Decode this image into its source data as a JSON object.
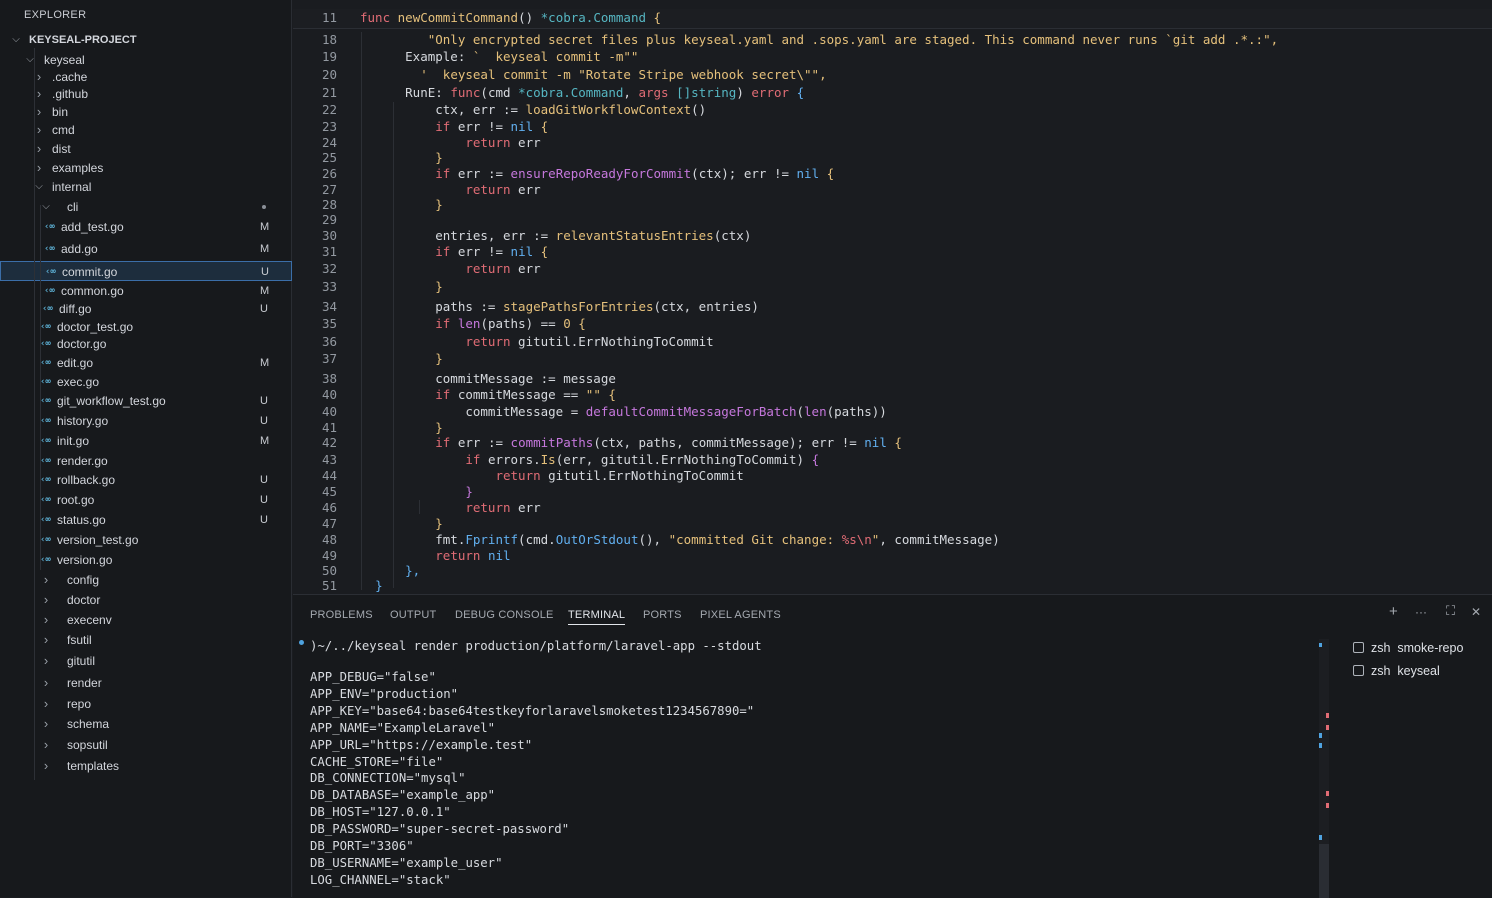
{
  "explorer": {
    "title": "EXPLORER",
    "project": "KEYSEAL-PROJECT",
    "items": [
      {
        "label": "keyseal",
        "kind": "folder-open",
        "depth": 1
      },
      {
        "label": ".cache",
        "kind": "folder",
        "depth": 2
      },
      {
        "label": ".github",
        "kind": "folder",
        "depth": 2
      },
      {
        "label": "bin",
        "kind": "folder",
        "depth": 2
      },
      {
        "label": "cmd",
        "kind": "folder",
        "depth": 2
      },
      {
        "label": "dist",
        "kind": "folder",
        "depth": 2
      },
      {
        "label": "examples",
        "kind": "folder",
        "depth": 2
      },
      {
        "label": "internal",
        "kind": "folder-open",
        "depth": 2
      },
      {
        "label": "cli",
        "kind": "folder-open",
        "depth": 3,
        "dot": true
      },
      {
        "label": "add_test.go",
        "kind": "go",
        "depth": 4,
        "status": "M"
      },
      {
        "label": "add.go",
        "kind": "go",
        "depth": 4,
        "status": "M"
      },
      {
        "label": "commit.go",
        "kind": "go",
        "depth": 4,
        "status": "U",
        "selected": true
      },
      {
        "label": "common.go",
        "kind": "go",
        "depth": 4,
        "status": "M"
      },
      {
        "label": "diff.go",
        "kind": "go",
        "depth": 4,
        "status": "U"
      },
      {
        "label": "doctor_test.go",
        "kind": "go",
        "depth": 4
      },
      {
        "label": "doctor.go",
        "kind": "go",
        "depth": 4
      },
      {
        "label": "edit.go",
        "kind": "go",
        "depth": 4,
        "status": "M"
      },
      {
        "label": "exec.go",
        "kind": "go",
        "depth": 4
      },
      {
        "label": "git_workflow_test.go",
        "kind": "go",
        "depth": 4,
        "status": "U"
      },
      {
        "label": "history.go",
        "kind": "go",
        "depth": 4,
        "status": "U"
      },
      {
        "label": "init.go",
        "kind": "go",
        "depth": 4,
        "status": "M"
      },
      {
        "label": "render.go",
        "kind": "go",
        "depth": 4
      },
      {
        "label": "rollback.go",
        "kind": "go",
        "depth": 4,
        "status": "U"
      },
      {
        "label": "root.go",
        "kind": "go",
        "depth": 4,
        "status": "U"
      },
      {
        "label": "status.go",
        "kind": "go",
        "depth": 4,
        "status": "U"
      },
      {
        "label": "version_test.go",
        "kind": "go",
        "depth": 4
      },
      {
        "label": "version.go",
        "kind": "go",
        "depth": 4
      },
      {
        "label": "config",
        "kind": "folder",
        "depth": 3
      },
      {
        "label": "doctor",
        "kind": "folder",
        "depth": 3
      },
      {
        "label": "execenv",
        "kind": "folder",
        "depth": 3
      },
      {
        "label": "fsutil",
        "kind": "folder",
        "depth": 3
      },
      {
        "label": "gitutil",
        "kind": "folder",
        "depth": 3
      },
      {
        "label": "render",
        "kind": "folder",
        "depth": 3
      },
      {
        "label": "repo",
        "kind": "folder",
        "depth": 3
      },
      {
        "label": "schema",
        "kind": "folder",
        "depth": 3
      },
      {
        "label": "sopsutil",
        "kind": "folder",
        "depth": 3
      },
      {
        "label": "templates",
        "kind": "folder",
        "depth": 3
      }
    ]
  },
  "editor": {
    "file": "commit.go",
    "lines": [
      {
        "n": "11",
        "sticky": true,
        "tokens": [
          [
            "kw",
            "func "
          ],
          [
            "st",
            "newCommitCommand"
          ],
          [
            "pl",
            "() "
          ],
          [
            "ty",
            "*cobra.Command"
          ],
          [
            "br",
            " {"
          ]
        ]
      },
      {
        "n": "18",
        "tokens": [
          [
            "pl",
            "         "
          ],
          [
            "st",
            "\"Only encrypted secret files plus keyseal.yaml and .sops.yaml are staged. This command never runs `git add .*.:\","
          ]
        ]
      },
      {
        "n": "19",
        "tokens": [
          [
            "pl",
            "      Example: "
          ],
          [
            "st",
            "`  keyseal commit -m\"\""
          ]
        ]
      },
      {
        "n": "20",
        "tokens": [
          [
            "pl",
            "        "
          ],
          [
            "st",
            "'  keyseal commit -m \"Rotate Stripe webhook secret\\\"\","
          ]
        ]
      },
      {
        "n": "21",
        "tokens": [
          [
            "pl",
            "      RunE: "
          ],
          [
            "kw",
            "func"
          ],
          [
            "pl",
            "(cmd "
          ],
          [
            "ty",
            "*cobra.Command"
          ],
          [
            "pl",
            ", "
          ],
          [
            "kw",
            "args"
          ],
          [
            "pl",
            " "
          ],
          [
            "ty",
            "[]string"
          ],
          [
            "pl",
            ") "
          ],
          [
            "kw",
            "error"
          ],
          [
            "nl",
            " {"
          ]
        ]
      },
      {
        "n": "22",
        "tokens": [
          [
            "pl",
            "          ctx, err := "
          ],
          [
            "st",
            "loadGitWorkflowContext"
          ],
          [
            "pl",
            "()"
          ]
        ]
      },
      {
        "n": "23",
        "tokens": [
          [
            "pl",
            "          "
          ],
          [
            "kw",
            "if"
          ],
          [
            "pl",
            " err != "
          ],
          [
            "nl",
            "nil"
          ],
          [
            "br",
            " {"
          ]
        ]
      },
      {
        "n": "24",
        "tokens": [
          [
            "pl",
            "              "
          ],
          [
            "kw",
            "return"
          ],
          [
            "pl",
            " err"
          ]
        ]
      },
      {
        "n": "25",
        "tokens": [
          [
            "pl",
            "          "
          ],
          [
            "br",
            "}"
          ]
        ]
      },
      {
        "n": "26",
        "tokens": [
          [
            "pl",
            "          "
          ],
          [
            "kw",
            "if"
          ],
          [
            "pl",
            " err := "
          ],
          [
            "fn",
            "ensureRepoReadyForCommit"
          ],
          [
            "pl",
            "(ctx); err != "
          ],
          [
            "nl",
            "nil"
          ],
          [
            "br",
            " {"
          ]
        ]
      },
      {
        "n": "27",
        "tokens": [
          [
            "pl",
            "              "
          ],
          [
            "kw",
            "return"
          ],
          [
            "pl",
            " err"
          ]
        ]
      },
      {
        "n": "28",
        "tokens": [
          [
            "pl",
            "          "
          ],
          [
            "br",
            "}"
          ]
        ]
      },
      {
        "n": "29",
        "tokens": []
      },
      {
        "n": "30",
        "tokens": [
          [
            "pl",
            "          entries, err := "
          ],
          [
            "st",
            "relevantStatusEntries"
          ],
          [
            "pl",
            "(ctx)"
          ]
        ]
      },
      {
        "n": "31",
        "tokens": [
          [
            "pl",
            "          "
          ],
          [
            "kw",
            "if"
          ],
          [
            "pl",
            " err != "
          ],
          [
            "nl",
            "nil"
          ],
          [
            "br",
            " {"
          ]
        ]
      },
      {
        "n": "32",
        "tokens": [
          [
            "pl",
            "              "
          ],
          [
            "kw",
            "return"
          ],
          [
            "pl",
            " err"
          ]
        ]
      },
      {
        "n": "33",
        "tokens": [
          [
            "pl",
            "          "
          ],
          [
            "br",
            "}"
          ]
        ]
      },
      {
        "n": "34",
        "tokens": [
          [
            "pl",
            "          paths := "
          ],
          [
            "st",
            "stagePathsForEntries"
          ],
          [
            "pl",
            "(ctx, entries)"
          ]
        ]
      },
      {
        "n": "35",
        "tokens": [
          [
            "pl",
            "          "
          ],
          [
            "kw",
            "if"
          ],
          [
            "pl",
            " "
          ],
          [
            "fn",
            "len"
          ],
          [
            "pl",
            "(paths) == "
          ],
          [
            "st",
            "0"
          ],
          [
            "br",
            " {"
          ]
        ]
      },
      {
        "n": "36",
        "tokens": [
          [
            "pl",
            "              "
          ],
          [
            "kw",
            "return"
          ],
          [
            "pl",
            " gitutil.ErrNothingToCommit"
          ]
        ]
      },
      {
        "n": "37",
        "tokens": [
          [
            "pl",
            "          "
          ],
          [
            "br",
            "}"
          ]
        ]
      },
      {
        "n": "38",
        "tokens": [
          [
            "pl",
            "          commitMessage := message"
          ]
        ]
      },
      {
        "n": "40",
        "tokens": [
          [
            "pl",
            "          "
          ],
          [
            "kw",
            "if"
          ],
          [
            "pl",
            " commitMessage == "
          ],
          [
            "st",
            "\"\""
          ],
          [
            "br",
            " {"
          ]
        ]
      },
      {
        "n": "40",
        "tokens": [
          [
            "pl",
            "              commitMessage = "
          ],
          [
            "fn",
            "defaultCommitMessageForBatch"
          ],
          [
            "pl",
            "("
          ],
          [
            "fn",
            "len"
          ],
          [
            "pl",
            "(paths))"
          ]
        ]
      },
      {
        "n": "41",
        "tokens": [
          [
            "pl",
            "          "
          ],
          [
            "br",
            "}"
          ]
        ]
      },
      {
        "n": "42",
        "tokens": [
          [
            "pl",
            "          "
          ],
          [
            "kw",
            "if"
          ],
          [
            "pl",
            " err := "
          ],
          [
            "fn",
            "commitPaths"
          ],
          [
            "pl",
            "(ctx, paths, commitMessage); err != "
          ],
          [
            "nl",
            "nil"
          ],
          [
            "br",
            " {"
          ]
        ]
      },
      {
        "n": "43",
        "tokens": [
          [
            "pl",
            "              "
          ],
          [
            "kw",
            "if"
          ],
          [
            "pl",
            " errors."
          ],
          [
            "st",
            "Is"
          ],
          [
            "pl",
            "(err, gitutil.ErrNothingToCommit) "
          ],
          [
            "fn",
            "{"
          ]
        ]
      },
      {
        "n": "44",
        "tokens": [
          [
            "pl",
            "                  "
          ],
          [
            "kw",
            "return"
          ],
          [
            "pl",
            " gitutil.ErrNothingToCommit"
          ]
        ]
      },
      {
        "n": "45",
        "tokens": [
          [
            "pl",
            "              "
          ],
          [
            "fn",
            "}"
          ]
        ]
      },
      {
        "n": "46",
        "tokens": [
          [
            "pl",
            "              "
          ],
          [
            "kw",
            "return"
          ],
          [
            "pl",
            " err"
          ]
        ]
      },
      {
        "n": "47",
        "tokens": [
          [
            "pl",
            "          "
          ],
          [
            "br",
            "}"
          ]
        ]
      },
      {
        "n": "48",
        "tokens": [
          [
            "pl",
            "          fmt."
          ],
          [
            "nl",
            "Fprintf"
          ],
          [
            "pl",
            "(cmd."
          ],
          [
            "nl",
            "OutOrStdout"
          ],
          [
            "pl",
            "(), "
          ],
          [
            "st",
            "\"committed Git change: "
          ],
          [
            "kw",
            "%s\\n"
          ],
          [
            "st",
            "\""
          ],
          [
            "pl",
            ", commitMessage)"
          ]
        ]
      },
      {
        "n": "49",
        "tokens": [
          [
            "pl",
            "          "
          ],
          [
            "kw",
            "return"
          ],
          [
            "pl",
            " "
          ],
          [
            "nl",
            "nil"
          ]
        ]
      },
      {
        "n": "50",
        "tokens": [
          [
            "pl",
            "      "
          ],
          [
            "nl",
            "},"
          ]
        ]
      },
      {
        "n": "51",
        "tokens": [
          [
            "pl",
            "  "
          ],
          [
            "nl",
            "}"
          ]
        ]
      }
    ]
  },
  "panel": {
    "tabs": [
      "PROBLEMS",
      "OUTPUT",
      "DEBUG CONSOLE",
      "TERMINAL",
      "PORTS",
      "PIXEL AGENTS"
    ],
    "active_tab": "TERMINAL",
    "controls": {
      "add": "+",
      "more": "···",
      "maximize": "⛶",
      "close": "✕"
    },
    "terminal": {
      "prompt": ")~/../keyseal render production/platform/laravel-app --stdout",
      "output": [
        "APP_DEBUG=\"false\"",
        "APP_ENV=\"production\"",
        "APP_KEY=\"base64:base64testkeyforlaravelsmoketest1234567890=\"",
        "APP_NAME=\"ExampleLaravel\"",
        "APP_URL=\"https://example.test\"",
        "CACHE_STORE=\"file\"",
        "DB_CONNECTION=\"mysql\"",
        "DB_DATABASE=\"example_app\"",
        "DB_HOST=\"127.0.0.1\"",
        "DB_PASSWORD=\"super-secret-password\"",
        "DB_PORT=\"3306\"",
        "DB_USERNAME=\"example_user\"",
        "LOG_CHANNEL=\"stack\""
      ]
    },
    "terminal_list": [
      "zsh  smoke-repo",
      "zsh  keyseal"
    ]
  },
  "colors": {
    "accent": "#3b6ea8",
    "go_icon": "#5eb3d8",
    "keyword": "#e06c75",
    "function": "#c678dd",
    "type": "#56b6c2",
    "string": "#e5c07b",
    "builtin": "#61afef"
  }
}
